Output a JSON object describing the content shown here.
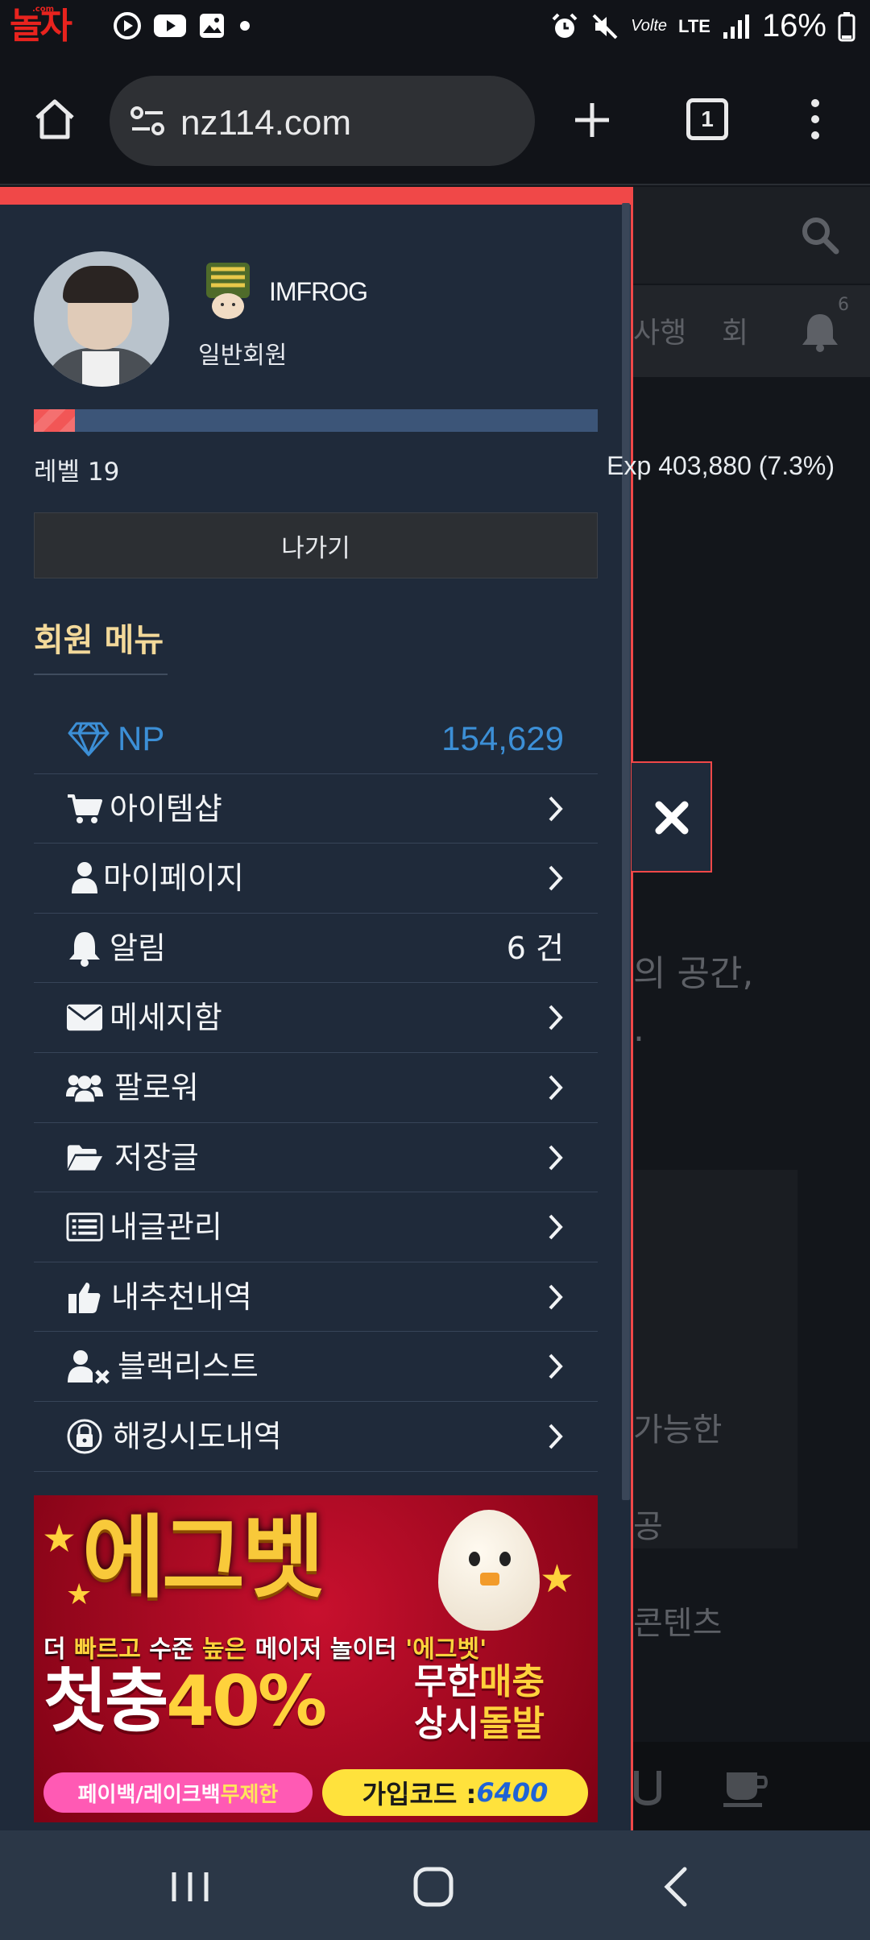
{
  "status_bar": {
    "logo_text": "놀자",
    "logo_com": ".com",
    "network_text": "LTE",
    "volte_text": "Volte",
    "battery_pct": "16%"
  },
  "browser": {
    "url": "nz114.com",
    "tab_count": "1"
  },
  "background_page": {
    "nav_text_1": "사행",
    "nav_text_2": "회",
    "notif_count": "6",
    "body_line_1": "의 공간,",
    "body_line_2": ".",
    "box_line_1": "가능한",
    "box_line_2": "공",
    "box_line_3": "콘텐츠"
  },
  "drawer": {
    "username": "IMFROG",
    "user_grade": "일반회원",
    "exp_fraction": 0.073,
    "level_text": "레벨 19",
    "exp_text": "Exp 403,880 (7.3%)",
    "logout_label": "나가기",
    "menu_title": "회원 메뉴",
    "menu": [
      {
        "icon": "diamond-icon",
        "label": "NP",
        "value": "154,629"
      },
      {
        "icon": "cart-icon",
        "label": "아이템샵"
      },
      {
        "icon": "user-icon",
        "label": "마이페이지"
      },
      {
        "icon": "bell-icon",
        "label": "알림",
        "value": "6 건"
      },
      {
        "icon": "envelope-icon",
        "label": "메세지함"
      },
      {
        "icon": "users-icon",
        "label": "팔로워"
      },
      {
        "icon": "folder-open-icon",
        "label": "저장글"
      },
      {
        "icon": "list-alt-icon",
        "label": "내글관리"
      },
      {
        "icon": "thumbs-up-icon",
        "label": "내추천내역"
      },
      {
        "icon": "user-block-icon",
        "label": "블랙리스트"
      },
      {
        "icon": "lock-icon",
        "label": "해킹시도내역"
      }
    ]
  },
  "ad": {
    "brand": "에그벳",
    "tagline_a": "더 ",
    "tagline_b": "빠르고",
    "tagline_c": " 수준 ",
    "tagline_d": "높은",
    "tagline_e": " 메이저 놀이터 ",
    "tagline_f": "'에그벳'",
    "promo_a": "첫충",
    "promo_b": "40%",
    "side_1a": "무한",
    "side_1b": "매충",
    "side_2a": "상시",
    "side_2b": "돌발",
    "payback_a": "페이백/레이크백 ",
    "payback_b": "무제한",
    "code_label": "가입코드 : ",
    "code_value": "6400"
  },
  "colors": {
    "accent_red": "#f04848",
    "drawer_bg": "#1f2a3a",
    "np_blue": "#3c8fd6",
    "menu_title_gold": "#f3d99a"
  }
}
